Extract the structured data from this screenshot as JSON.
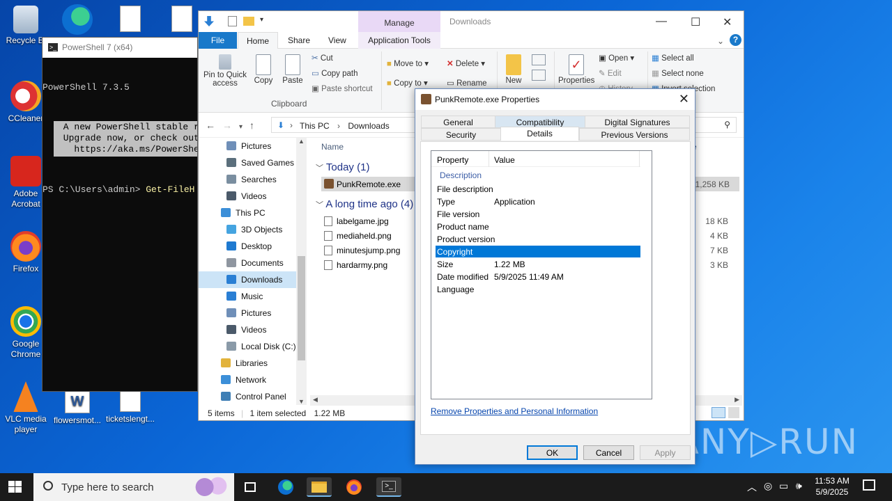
{
  "desktop": {
    "icons": [
      {
        "label": "Recycle Bin",
        "short": "Recycle Bi"
      },
      {
        "label": "CCleaner"
      },
      {
        "label": "Adobe Acrobat",
        "l1": "Adobe",
        "l2": "Acrobat"
      },
      {
        "label": "Firefox"
      },
      {
        "label": "Google Chrome",
        "l1": "Google",
        "l2": "Chrome"
      },
      {
        "label": "VLC media player",
        "l1": "VLC media",
        "l2": "player"
      },
      {
        "label": "flowersmot..."
      },
      {
        "label": "ticketslengt..."
      }
    ],
    "watermark": "ANY▷RUN"
  },
  "powershell": {
    "title": "PowerShell 7 (x64)",
    "version_line": "PowerShell 7.3.5",
    "banner_lines": [
      " A new PowerShell stable r",
      " Upgrade now, or check out",
      "   https://aka.ms/PowerShe"
    ],
    "prompt": "PS C:\\Users\\admin> ",
    "command": "Get-FileH"
  },
  "explorer": {
    "window_title": "Downloads",
    "manage_tab": "Manage",
    "tabs": {
      "file": "File",
      "home": "Home",
      "share": "Share",
      "view": "View",
      "app_tools": "Application Tools"
    },
    "ribbon": {
      "pin": "Pin to Quick access",
      "pin_l1": "Pin to Quick",
      "pin_l2": "access",
      "copy": "Copy",
      "paste": "Paste",
      "cut": "Cut",
      "copy_path": "Copy path",
      "paste_shortcut": "Paste shortcut",
      "clipboard_group": "Clipboard",
      "move_to": "Move to",
      "copy_to": "Copy to",
      "delete": "Delete",
      "rename": "Rename",
      "new": "New",
      "properties": "Properties",
      "open": "Open",
      "edit": "Edit",
      "history": "History",
      "select_all": "Select all",
      "select_none": "Select none",
      "invert_selection": "Invert selection"
    },
    "address": {
      "segments": [
        "This PC",
        "Downloads"
      ]
    },
    "nav": [
      {
        "label": "Pictures",
        "level": 1,
        "color": "#6f8fb8"
      },
      {
        "label": "Saved Games",
        "level": 1,
        "color": "#5b6f7c"
      },
      {
        "label": "Searches",
        "level": 1,
        "color": "#7a8ea0"
      },
      {
        "label": "Videos",
        "level": 1,
        "color": "#4b5a6a"
      },
      {
        "label": "This PC",
        "level": 0,
        "color": "#3c8fd8"
      },
      {
        "label": "3D Objects",
        "level": 1,
        "color": "#45a4e0"
      },
      {
        "label": "Desktop",
        "level": 1,
        "color": "#1f7ad0"
      },
      {
        "label": "Documents",
        "level": 1,
        "color": "#8f96a0"
      },
      {
        "label": "Downloads",
        "level": 1,
        "color": "#2a7fd4",
        "selected": true
      },
      {
        "label": "Music",
        "level": 1,
        "color": "#2a7fd4"
      },
      {
        "label": "Pictures",
        "level": 1,
        "color": "#6f8fb8"
      },
      {
        "label": "Videos",
        "level": 1,
        "color": "#4b5a6a"
      },
      {
        "label": "Local Disk (C:)",
        "level": 1,
        "color": "#8a9aa8"
      },
      {
        "label": "Libraries",
        "level": 0,
        "color": "#e2b33c"
      },
      {
        "label": "Network",
        "level": 0,
        "color": "#3c8fd8"
      },
      {
        "label": "Control Panel",
        "level": 0,
        "color": "#3f7fb5"
      }
    ],
    "column_name": "Name",
    "column_size_fragment": "e",
    "groups": {
      "today": "Today (1)",
      "long_ago": "A long time ago (4)"
    },
    "files": [
      {
        "name": "PunkRemote.exe",
        "size": "1,258 KB",
        "selected": true
      },
      {
        "name": "labelgame.jpg",
        "size": "18 KB"
      },
      {
        "name": "mediaheld.png",
        "size": "4 KB"
      },
      {
        "name": "minutesjump.png",
        "size": "7 KB"
      },
      {
        "name": "hardarmy.png",
        "size": "3 KB"
      }
    ],
    "status": {
      "count": "5 items",
      "selected": "1 item selected",
      "size": "1.22 MB"
    }
  },
  "properties": {
    "title": "PunkRemote.exe Properties",
    "tabs": {
      "general": "General",
      "compatibility": "Compatibility",
      "digital_signatures": "Digital Signatures",
      "security": "Security",
      "details": "Details",
      "previous_versions": "Previous Versions"
    },
    "header": {
      "property": "Property",
      "value": "Value"
    },
    "group_description": "Description",
    "rows": [
      {
        "property": "File description",
        "value": ""
      },
      {
        "property": "Type",
        "value": "Application"
      },
      {
        "property": "File version",
        "value": ""
      },
      {
        "property": "Product name",
        "value": ""
      },
      {
        "property": "Product version",
        "value": ""
      },
      {
        "property": "Copyright",
        "value": "",
        "selected": true
      },
      {
        "property": "Size",
        "value": "1.22 MB"
      },
      {
        "property": "Date modified",
        "value": "5/9/2025 11:49 AM"
      },
      {
        "property": "Language",
        "value": ""
      }
    ],
    "remove_link": "Remove Properties and Personal Information",
    "buttons": {
      "ok": "OK",
      "cancel": "Cancel",
      "apply": "Apply"
    }
  },
  "taskbar": {
    "search_placeholder": "Type here to search",
    "time": "11:53 AM",
    "date": "5/9/2025"
  }
}
